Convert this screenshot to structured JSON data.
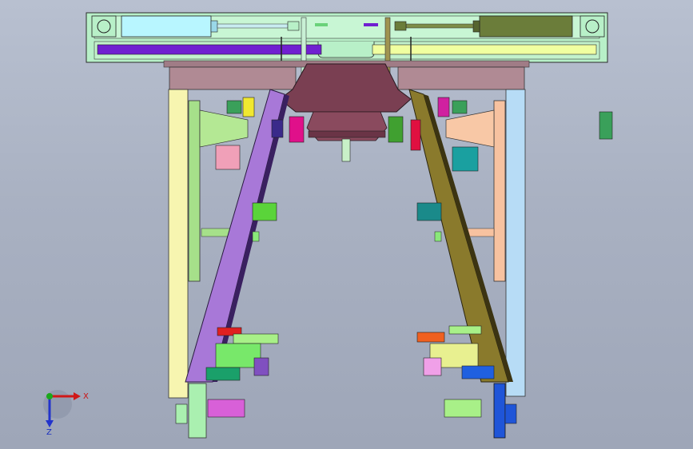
{
  "viewport": {
    "background_top": "#b8c0d0",
    "background_bottom": "#9ea6b8"
  },
  "triad": {
    "x_label": "X",
    "z_label": "Z",
    "x_color": "#d01818",
    "y_color": "#1aa81a",
    "z_color": "#2233cc"
  },
  "colors": {
    "top_rail": "#b8f0c8",
    "left_cylinder": "#b8f6ff",
    "right_cylinder": "#6b7d3a",
    "purple_bar": "#7020d0",
    "yellow_bar": "#f0ffa0",
    "beam_mauve": "#b08a94",
    "center_hub": "#7a3f52",
    "left_brace": "#a878d8",
    "right_brace": "#8a7a2c",
    "left_column": "#f7f5b0",
    "right_column": "#b7dcf6",
    "left_plate": "#a6e08a",
    "right_plate": "#f7c2a0",
    "bottom_left_column": "#aaf0b0",
    "bottom_right_column": "#1f55d8"
  }
}
